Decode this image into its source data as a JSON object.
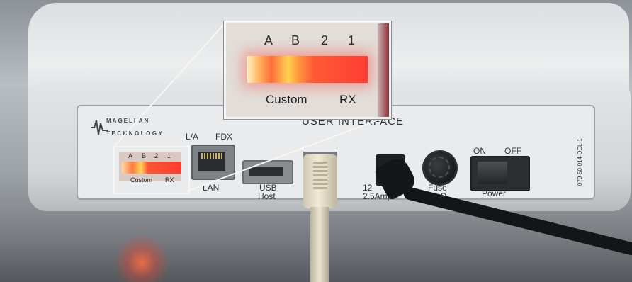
{
  "inset": {
    "channels": [
      "A",
      "B",
      "2",
      "1"
    ],
    "left_caption": "Custom",
    "right_caption": "RX"
  },
  "device": {
    "logo_line1": "MAGELLAN",
    "logo_line2": "TECHNOLOGY",
    "panel_title": "USER INTERFACE",
    "mini_channels": [
      "A",
      "B",
      "2",
      "1"
    ],
    "mini_left_caption": "Custom",
    "mini_right_caption": "RX",
    "lan_top_left": "L/A",
    "lan_top_right": "FDX",
    "lan_label": "LAN",
    "usb_host_line1": "USB",
    "usb_host_line2": "Host",
    "dc_line1": "12",
    "dc_line2": "2.5Amp",
    "fuse_label": "Fuse",
    "fuse_label2": "P",
    "power_on": "ON",
    "power_off": "OFF",
    "power_label": "Power",
    "serial_number": "079-50-014-DCL-1"
  },
  "colors": {
    "led_red": "#ff3d33",
    "led_yellow": "#ffd24f",
    "case": "#dcdfe1",
    "cable_usb": "#e6dfca",
    "cable_power": "#141516"
  }
}
